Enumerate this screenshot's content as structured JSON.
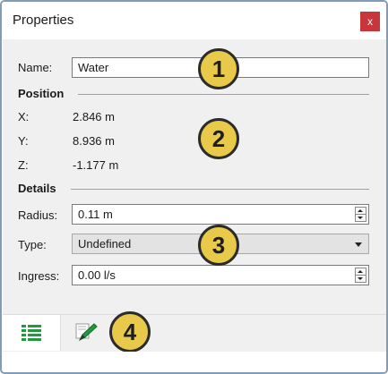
{
  "window": {
    "title": "Properties",
    "close_glyph": "x"
  },
  "name_row": {
    "label": "Name:",
    "value": "Water"
  },
  "position": {
    "heading": "Position",
    "x_label": "X:",
    "x_value": "2.846 m",
    "y_label": "Y:",
    "y_value": "8.936 m",
    "z_label": "Z:",
    "z_value": "-1.177 m"
  },
  "details": {
    "heading": "Details",
    "radius_label": "Radius:",
    "radius_value": "0.11 m",
    "type_label": "Type:",
    "type_value": "Undefined",
    "ingress_label": "Ingress:",
    "ingress_value": "0.00 l/s"
  },
  "callouts": [
    "1",
    "2",
    "3",
    "4"
  ],
  "tabs": [
    {
      "icon": "list-icon",
      "active": true
    },
    {
      "icon": "pencil-edit-icon",
      "active": false
    }
  ],
  "colors": {
    "callout_fill": "#e9c94a",
    "close_button": "#c8353a",
    "list_icon": "#1f9a3c",
    "pencil_icon": "#1f9a3c"
  }
}
